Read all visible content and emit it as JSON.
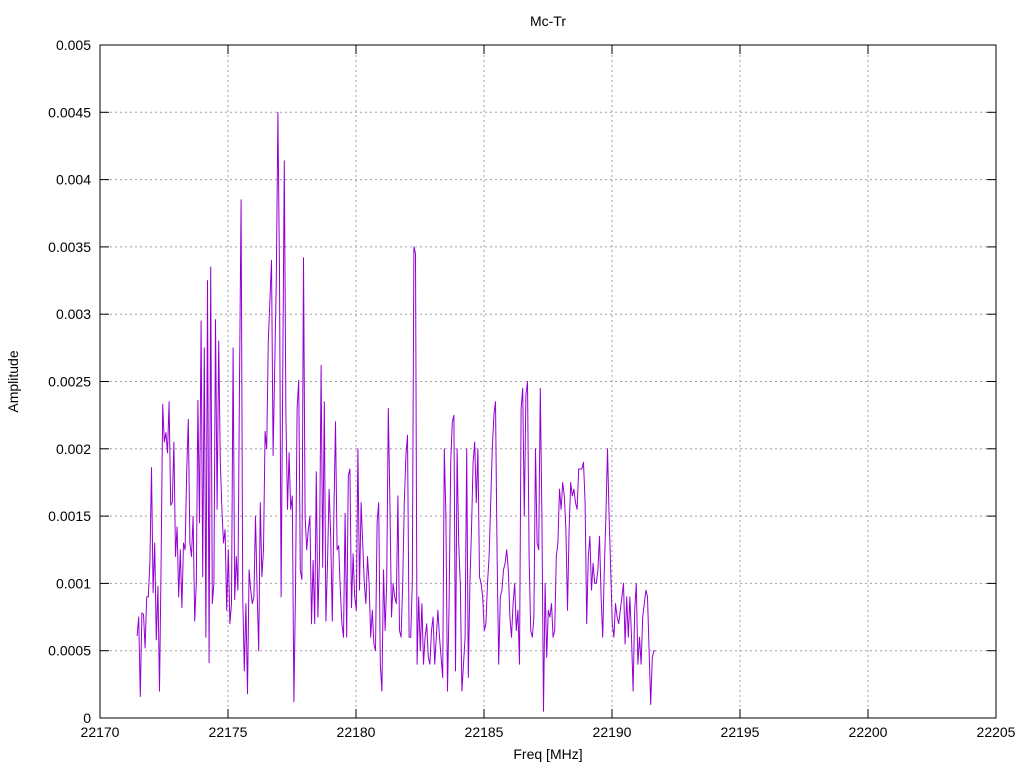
{
  "chart_data": {
    "type": "line",
    "title": "Mc-Tr",
    "xlabel": "Freq [MHz]",
    "ylabel": "Amplitude",
    "xlim": [
      22170,
      22205
    ],
    "ylim": [
      0,
      0.005
    ],
    "grid": true,
    "x_ticks": [
      "22170",
      "22175",
      "22180",
      "22185",
      "22190",
      "22195",
      "22200",
      "22205"
    ],
    "y_ticks": [
      "0",
      "0.0005",
      "0.001",
      "0.0015",
      "0.002",
      "0.0025",
      "0.003",
      "0.0035",
      "0.004",
      "0.0045",
      "0.005"
    ],
    "series": [
      {
        "color": "#9400d3",
        "x_start": 22171.45,
        "x_step": 0.0625,
        "values": [
          0.00061,
          0.00075,
          0.00016,
          0.00078,
          0.00077,
          0.00052,
          0.0009,
          0.0009,
          0.00115,
          0.00186,
          0.00093,
          0.0013,
          0.00058,
          0.00098,
          0.0002,
          0.00115,
          0.00233,
          0.00205,
          0.00212,
          0.00197,
          0.00235,
          0.00158,
          0.0016,
          0.00205,
          0.0012,
          0.00142,
          0.0009,
          0.00125,
          0.00082,
          0.0013,
          0.00125,
          0.00183,
          0.00222,
          0.0013,
          0.0012,
          0.0015,
          0.00072,
          0.001,
          0.00236,
          0.00145,
          0.00295,
          0.00105,
          0.00275,
          0.0006,
          0.00325,
          0.00041,
          0.00335,
          0.00085,
          0.001,
          0.00296,
          0.00155,
          0.0028,
          0.0019,
          0.00155,
          0.0013,
          0.0014,
          0.0008,
          0.00125,
          0.0007,
          0.00085,
          0.00275,
          0.00088,
          0.0012,
          0.00095,
          0.0025,
          0.00385,
          0.00092,
          0.00035,
          0.00085,
          0.00018,
          0.0011,
          0.00095,
          0.00085,
          0.0009,
          0.0015,
          0.00095,
          0.0005,
          0.0016,
          0.00105,
          0.00125,
          0.00213,
          0.002,
          0.0028,
          0.0031,
          0.0034,
          0.00195,
          0.0026,
          0.00325,
          0.0045,
          0.0033,
          0.0009,
          0.0025,
          0.00414,
          0.00225,
          0.00155,
          0.00197,
          0.00155,
          0.00165,
          0.00012,
          0.00095,
          0.0023,
          0.00251,
          0.0011,
          0.00103,
          0.00342,
          0.0015,
          0.00125,
          0.0014,
          0.0015,
          0.0007,
          0.00117,
          0.0007,
          0.00183,
          0.00075,
          0.0012,
          0.00262,
          0.00112,
          0.00235,
          0.00072,
          0.00115,
          0.0017,
          0.00135,
          0.00072,
          0.00153,
          0.0022,
          0.00125,
          0.00128,
          0.00095,
          0.0007,
          0.0006,
          0.00152,
          0.0006,
          0.0018,
          0.00185,
          0.00082,
          0.00122,
          0.0009,
          0.0008,
          0.002,
          0.00095,
          0.0016,
          0.0013,
          0.001,
          0.00085,
          0.0012,
          0.001,
          0.0006,
          0.0008,
          0.00055,
          0.0005,
          0.00145,
          0.0016,
          0.0004,
          0.0002,
          0.0011,
          0.00065,
          0.001,
          0.0023,
          0.0016,
          0.00075,
          0.001,
          0.0009,
          0.00085,
          0.00165,
          0.00065,
          0.0006,
          0.001,
          0.0016,
          0.00195,
          0.0021,
          0.0006,
          0.0006,
          0.001,
          0.0035,
          0.00345,
          0.0004,
          0.0009,
          0.0005,
          0.00085,
          0.0004,
          0.0006,
          0.0007,
          0.00045,
          0.0004,
          0.00065,
          0.00075,
          0.0004,
          0.0006,
          0.0008,
          0.0006,
          0.00045,
          0.0003,
          0.002,
          0.0015,
          0.0002,
          0.00085,
          0.0019,
          0.0022,
          0.00225,
          0.00035,
          0.002,
          0.0013,
          0.001,
          0.0002,
          0.0004,
          0.0006,
          0.002,
          0.0003,
          0.001,
          0.0014,
          0.0019,
          0.00205,
          0.0016,
          0.002,
          0.00105,
          0.001,
          0.0009,
          0.00065,
          0.0007,
          0.001,
          0.0012,
          0.0016,
          0.002,
          0.00225,
          0.00235,
          0.0012,
          0.0004,
          0.0009,
          0.00095,
          0.0011,
          0.00115,
          0.00125,
          0.0011,
          0.00075,
          0.0006,
          0.00085,
          0.001,
          0.00065,
          0.0008,
          0.0004,
          0.0023,
          0.00245,
          0.0015,
          0.0024,
          0.0025,
          0.0012,
          0.00065,
          0.0006,
          0.00075,
          0.002,
          0.0013,
          0.00125,
          0.00245,
          0.0015,
          5e-05,
          0.001,
          0.00045,
          0.0008,
          0.00075,
          0.00085,
          0.0006,
          0.00065,
          0.0012,
          0.0013,
          0.0017,
          0.00155,
          0.00175,
          0.00165,
          0.0014,
          0.0008,
          0.0014,
          0.00175,
          0.00165,
          0.0017,
          0.0016,
          0.00155,
          0.00185,
          0.00185,
          0.00185,
          0.0019,
          0.0016,
          0.0007,
          0.0012,
          0.00135,
          0.00095,
          0.00115,
          0.001,
          0.001,
          0.0011,
          0.00135,
          0.0009,
          0.0006,
          0.0011,
          0.0015,
          0.002,
          0.0015,
          0.0011,
          0.0007,
          0.0006,
          0.00085,
          0.00075,
          0.0007,
          0.0008,
          0.0009,
          0.001,
          0.00055,
          0.0009,
          0.0006,
          0.0009,
          0.0006,
          0.0002,
          0.0008,
          0.001,
          0.0004,
          0.0006,
          0.0004,
          0.00075,
          0.00085,
          0.00095,
          0.0009,
          0.0005,
          0.0001,
          0.00045,
          0.0005,
          0.0005
        ]
      }
    ]
  }
}
